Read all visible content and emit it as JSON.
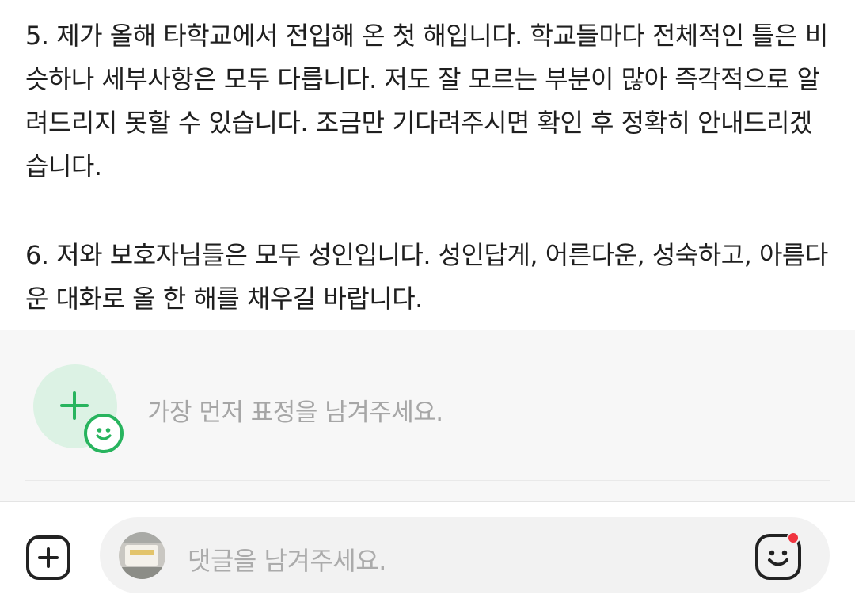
{
  "post": {
    "paragraphs": [
      "5. 제가 올해 타학교에서 전입해 온 첫 해입니다. 학교들마다 전체적인 틀은 비슷하나 세부사항은 모두 다릅니다. 저도 잘 모르는 부분이 많아 즉각적으로 알려드리지 못할 수 있습니다. 조금만 기다려주시면 확인 후 정확히 안내드리겠습니다.",
      "6. 저와 보호자님들은 모두 성인입니다. 성인답게, 어른다운, 성숙하고, 아름다운 대화로 올 한 해를 채우길 바랍니다."
    ]
  },
  "reactions": {
    "prompt": "가장 먼저 표정을 남겨주세요.",
    "add_icon": "add-reaction-icon",
    "accent_color": "#28b45e"
  },
  "comment_bar": {
    "placeholder": "댓글을 남겨주세요.",
    "attach_icon": "plus-square-icon",
    "emoji_icon": "smile-icon",
    "badge_color": "#f0343f"
  }
}
